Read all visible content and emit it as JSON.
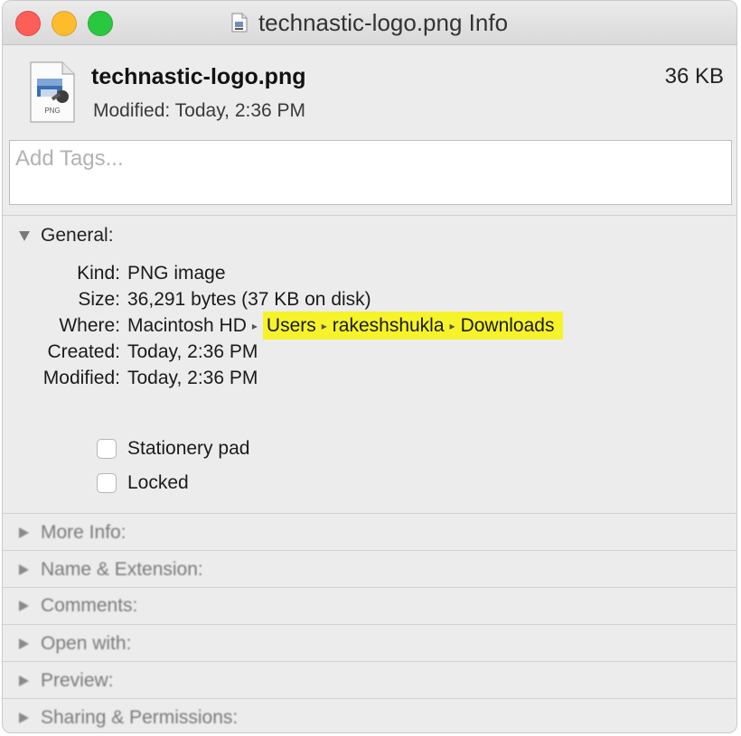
{
  "window": {
    "title": "technastic-logo.png Info"
  },
  "header": {
    "icon": "png-file-icon",
    "icon_badge": "PNG",
    "name": "technastic-logo.png",
    "modified": "Modified: Today, 2:36 PM",
    "size": "36 KB"
  },
  "tags": {
    "placeholder": "Add Tags..."
  },
  "general": {
    "title": "General:",
    "rows": [
      {
        "label": "Kind:",
        "value": "PNG image"
      },
      {
        "label": "Size:",
        "value": "36,291 bytes (37 KB on disk)"
      },
      {
        "label": "Where:",
        "path": [
          "Macintosh HD",
          "Users",
          "rakeshshukla",
          "Downloads"
        ]
      },
      {
        "label": "Created:",
        "value": "Today, 2:36 PM"
      },
      {
        "label": "Modified:",
        "value": "Today, 2:36 PM"
      }
    ],
    "checkboxes": [
      {
        "label": "Stationery pad",
        "checked": false
      },
      {
        "label": "Locked",
        "checked": false
      }
    ],
    "highlight_color": "#f6f32a"
  },
  "sections": [
    {
      "label": "More Info:"
    },
    {
      "label": "Name & Extension:"
    },
    {
      "label": "Comments:"
    },
    {
      "label": "Open with:"
    },
    {
      "label": "Preview:"
    },
    {
      "label": "Sharing & Permissions:"
    }
  ],
  "colors": {
    "close": "#fc5f57",
    "minimize": "#fdbc2e",
    "zoom": "#2ac841"
  }
}
